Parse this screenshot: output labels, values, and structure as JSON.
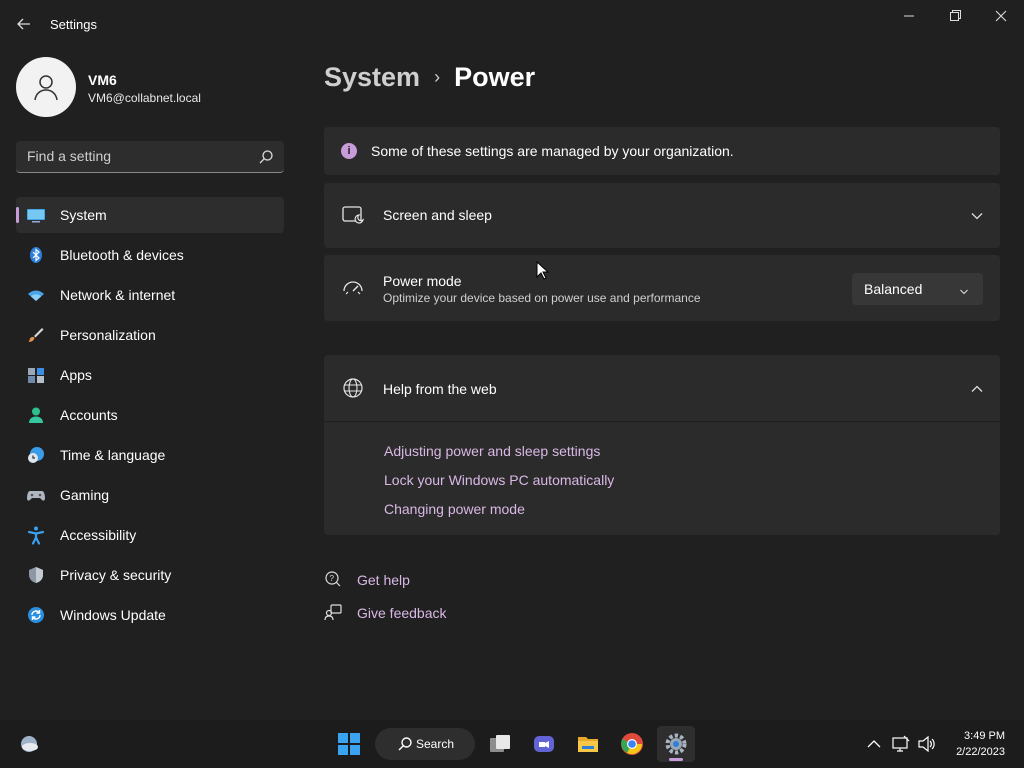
{
  "window": {
    "title": "Settings",
    "controls": [
      "minimize",
      "restore",
      "close"
    ]
  },
  "user": {
    "name": "VM6",
    "email": "VM6@collabnet.local"
  },
  "search": {
    "placeholder": "Find a setting"
  },
  "sidebar": {
    "items": [
      {
        "label": "System",
        "icon": "system-icon",
        "active": true
      },
      {
        "label": "Bluetooth & devices",
        "icon": "bluetooth-icon"
      },
      {
        "label": "Network & internet",
        "icon": "wifi-icon"
      },
      {
        "label": "Personalization",
        "icon": "brush-icon"
      },
      {
        "label": "Apps",
        "icon": "apps-icon"
      },
      {
        "label": "Accounts",
        "icon": "accounts-icon"
      },
      {
        "label": "Time & language",
        "icon": "clock-globe-icon"
      },
      {
        "label": "Gaming",
        "icon": "gamepad-icon"
      },
      {
        "label": "Accessibility",
        "icon": "accessibility-icon"
      },
      {
        "label": "Privacy & security",
        "icon": "shield-icon"
      },
      {
        "label": "Windows Update",
        "icon": "update-icon"
      }
    ]
  },
  "breadcrumb": {
    "parent": "System",
    "separator": "›",
    "current": "Power"
  },
  "info_bar": {
    "text": "Some of these settings are managed by your organization."
  },
  "screen_sleep": {
    "title": "Screen and sleep"
  },
  "power_mode": {
    "title": "Power mode",
    "description": "Optimize your device based on power use and performance",
    "value": "Balanced"
  },
  "help": {
    "title": "Help from the web",
    "links": [
      "Adjusting power and sleep settings",
      "Lock your Windows PC automatically",
      "Changing power mode"
    ]
  },
  "footer": {
    "get_help": "Get help",
    "give_feedback": "Give feedback"
  },
  "taskbar": {
    "search_label": "Search",
    "time": "3:49 PM",
    "date": "2/22/2023"
  },
  "colors": {
    "background": "#202020",
    "card": "#2b2b2b",
    "accent": "#c89bd9",
    "link": "#d9b8e6"
  }
}
